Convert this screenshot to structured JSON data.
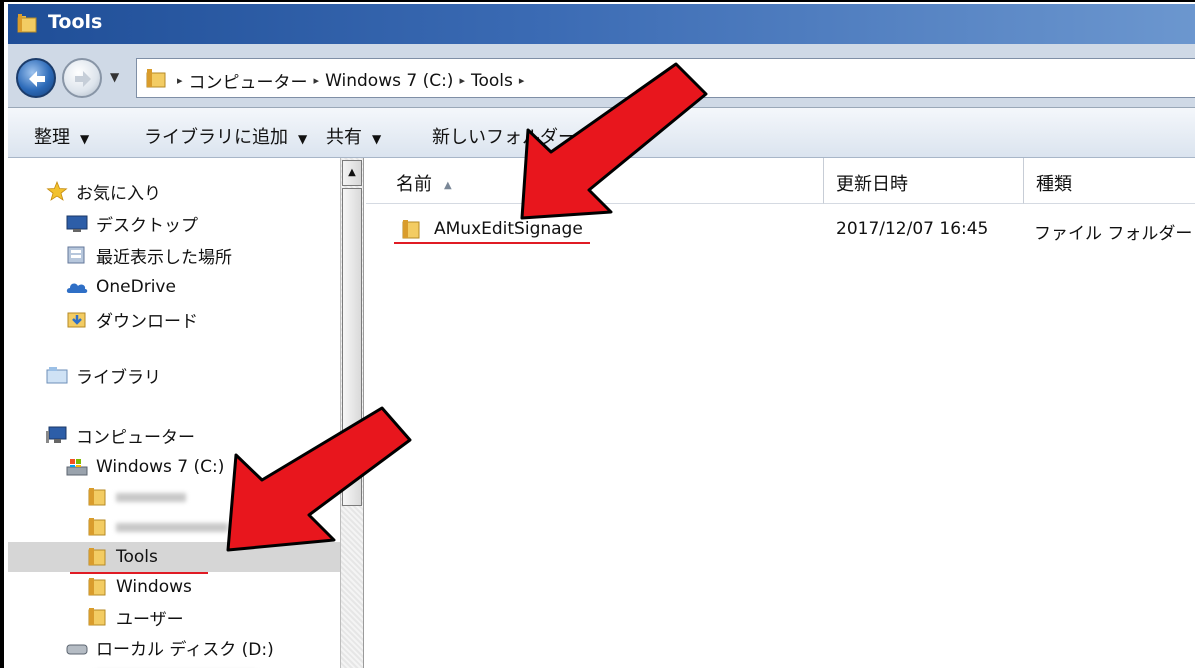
{
  "window": {
    "title": "Tools"
  },
  "address": {
    "crumbs": [
      "コンピューター",
      "Windows 7 (C:)",
      "Tools"
    ]
  },
  "toolbar": {
    "organize": "整理",
    "add_to_library": "ライブラリに追加",
    "share": "共有",
    "new_folder": "新しいフォルダー"
  },
  "navpane": {
    "favorites": "お気に入り",
    "desktop": "デスクトップ",
    "recent_places": "最近表示した場所",
    "onedrive": "OneDrive",
    "downloads": "ダウンロード",
    "libraries": "ライブラリ",
    "computer": "コンピューター",
    "windows7": "Windows 7 (C:)",
    "tools": "Tools",
    "windows": "Windows",
    "users": "ユーザー",
    "local_disk": "ローカル ディスク (D:)"
  },
  "columns": {
    "name": "名前",
    "modified": "更新日時",
    "type": "種類"
  },
  "files": [
    {
      "name": "AMuxEditSignage",
      "modified": "2017/12/07 16:45",
      "type": "ファイル フォルダー"
    }
  ],
  "icons": {
    "title": "folder-icon",
    "back": "back-arrow-icon",
    "forward": "forward-arrow-icon",
    "favorites": "star-icon",
    "desktop": "desktop-icon",
    "recent": "recent-places-icon",
    "onedrive": "cloud-icon",
    "downloads": "downloads-folder-icon",
    "libraries": "library-icon",
    "computer": "computer-icon",
    "drive": "drive-icon"
  },
  "colors": {
    "annotation": "#e01b24",
    "titlebar": "#1f4e97"
  }
}
